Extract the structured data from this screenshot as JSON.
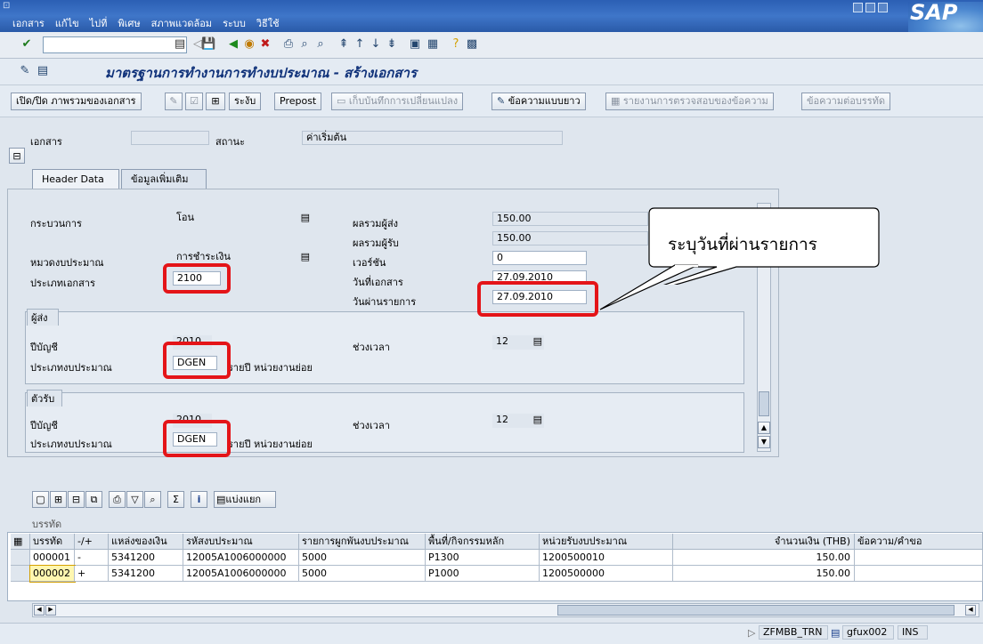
{
  "menu": [
    "เอกสาร",
    "แก้ไข",
    "ไปที่",
    "พิเศษ",
    "สภาพแวดล้อม",
    "ระบบ",
    "วิธีใช้"
  ],
  "brand": "SAP",
  "command_field": {
    "value": ""
  },
  "app_title": "มาตรฐานการทำงานการทำงบประมาณ - สร้างเอกสาร",
  "app_toolbar": {
    "overview": "เปิด/ปิด ภาพรวมของเอกสาร",
    "park": "ระงับ",
    "prepost": "Prepost",
    "save_changes": "เก็บบันทึกการเปลี่ยนแปลง",
    "long_text": "ข้อความแบบยาว",
    "text_check": "รายงานการตรวจสอบของข้อความ",
    "line_text": "ข้อความต่อบรรทัด"
  },
  "header": {
    "doc_label": "เอกสาร",
    "doc_value": "",
    "status_label": "สถานะ",
    "status_value": "ค่าเริ่มต้น"
  },
  "tabs": [
    "Header Data",
    "ข้อมูลเพิ่มเติม"
  ],
  "form": {
    "process_label": "กระบวนการ",
    "process_value": "โอน",
    "category_label": "หมวดงบประมาณ",
    "category_value": "การชำระเงิน",
    "doctype_label": "ประเภทเอกสาร",
    "doctype_value": "2100",
    "sender_total_label": "ผลรวมผู้ส่ง",
    "sender_total_value": "150.00",
    "receiver_total_label": "ผลรวมผู้รับ",
    "receiver_total_value": "150.00",
    "version_label": "เวอร์ชัน",
    "version_value": "0",
    "docdate_label": "วันที่เอกสาร",
    "docdate_value": "27.09.2010",
    "postdate_label": "วันผ่านรายการ",
    "postdate_value": "27.09.2010"
  },
  "sender": {
    "title": "ผู้ส่ง",
    "year_label": "ปีบัญชี",
    "year_value": "2010",
    "budtype_label": "ประเภทงบประมาณ",
    "budtype_value": "DGEN",
    "budtype_desc": "รายปี หน่วยงานย่อย",
    "period_label": "ช่วงเวลา",
    "period_value": "12"
  },
  "receiver": {
    "title": "ตัวรับ",
    "year_label": "ปีบัญชี",
    "year_value": "2010",
    "budtype_label": "ประเภทงบประมาณ",
    "budtype_value": "DGEN",
    "budtype_desc": "รายปี หน่วยงานย่อย",
    "period_label": "ช่วงเวลา",
    "period_value": "12"
  },
  "callout": "ระบุวันที่ผ่านรายการ",
  "grid": {
    "split_label": "แบ่งแยก",
    "section_label": "บรรทัด",
    "columns": [
      "บรรทัด",
      "-/+",
      "แหล่งของเงิน",
      "รหัสงบประมาณ",
      "รายการผูกพันงบประมาณ",
      "พื้นที่/กิจกรรมหลัก",
      "หน่วยรับงบประมาณ",
      "จำนวนเงิน (THB)",
      "ข้อความ/คำขอ"
    ],
    "rows": [
      [
        "000001",
        "-",
        "5341200",
        "12005A1006000000",
        "5000",
        "P1300",
        "1200500010",
        "150.00",
        ""
      ],
      [
        "000002",
        "+",
        "5341200",
        "12005A1006000000",
        "5000",
        "P1000",
        "1200500000",
        "150.00",
        ""
      ]
    ]
  },
  "status": {
    "transaction": "ZFMBB_TRN",
    "server": "gfux002",
    "mode": "INS"
  }
}
